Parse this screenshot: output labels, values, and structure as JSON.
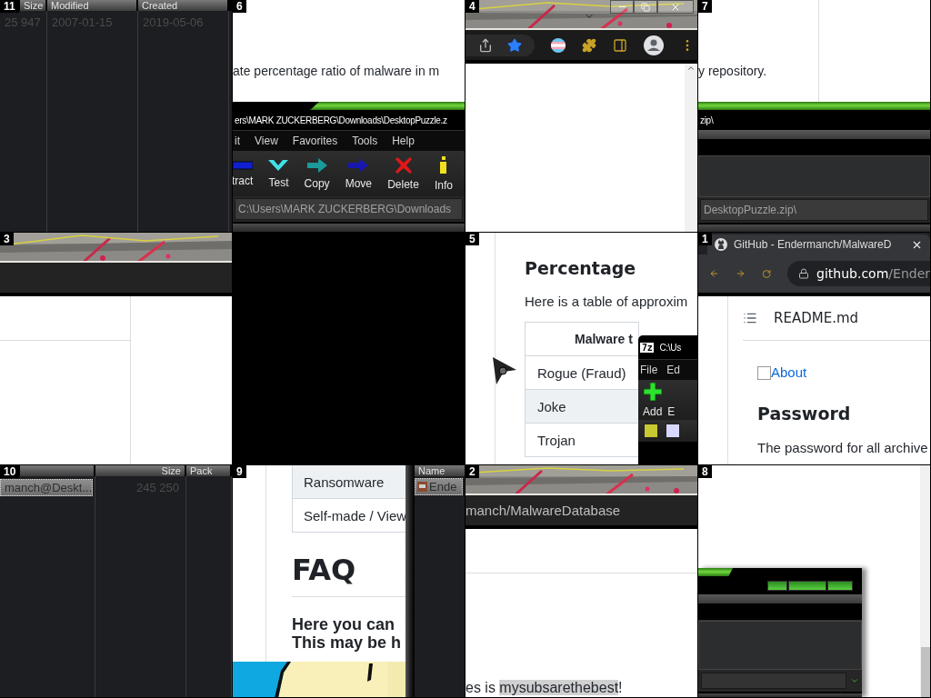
{
  "puzzle": {
    "tiles": [
      {
        "number": "11",
        "kind": "list_dates",
        "headers": [
          "Size",
          "Modified",
          "Created"
        ],
        "rows": [
          {
            "cells": [
              "25 947",
              "2007-01-15",
              "2019-05-06"
            ],
            "selected": false
          }
        ]
      },
      {
        "number": "6",
        "kind": "archive_toolbar",
        "text": "ate percentage ratio of malware in m",
        "title": "ers\\MARK ZUCKERBERG\\Downloads\\DesktopPuzzle.z",
        "menu": [
          "it",
          "View",
          "Favorites",
          "Tools",
          "Help"
        ],
        "tools": [
          {
            "label": "tract",
            "kind": "extract"
          },
          {
            "label": "Test",
            "kind": "test"
          },
          {
            "label": "Copy",
            "kind": "copy"
          },
          {
            "label": "Move",
            "kind": "move"
          },
          {
            "label": "Delete",
            "kind": "delete"
          },
          {
            "label": "Info",
            "kind": "info"
          }
        ],
        "path": "C:\\Users\\MARK ZUCKERBERG\\Downloads"
      },
      {
        "number": "4",
        "kind": "browser_toolbar"
      },
      {
        "number": "7",
        "kind": "archive_path",
        "text": "y repository.",
        "title": "zip\\",
        "path": "DesktopPuzzle.zip\\"
      },
      {
        "number": "3",
        "kind": "picture_bar"
      },
      {
        "kind": "empty"
      },
      {
        "number": "5",
        "kind": "percentage",
        "heading": "Percentage",
        "text": "Here is a table of approxim",
        "column": "Malware t",
        "rows": [
          {
            "label": "Rogue (Fraud)",
            "shaded": false
          },
          {
            "label": "Joke",
            "shaded": true
          },
          {
            "label": "Trojan",
            "shaded": false
          }
        ],
        "window": {
          "logo": "7z",
          "title": "C:\\Us",
          "menu": [
            "File",
            "Ed"
          ],
          "tools": [
            {
              "label": "Add",
              "kind": "add"
            },
            {
              "label": "E",
              "kind": "plain"
            }
          ]
        }
      },
      {
        "number": "1",
        "kind": "github",
        "tab": "GitHub - Endermanch/MalwareD",
        "host": "github.com",
        "path": "/Ender",
        "file": "README.md",
        "link": "About",
        "heading": "Password",
        "text": "The password for all archive"
      },
      {
        "number": "10",
        "kind": "list_names",
        "headers": [
          "Size",
          "Pack"
        ],
        "rows": [
          {
            "cells": [
              "manch@Deskt...",
              "245 250"
            ],
            "selected": true
          }
        ]
      },
      {
        "number": "9",
        "kind": "faq",
        "rows": [
          {
            "label": "Ransomware",
            "shaded": true
          },
          {
            "label": "Self-made / View",
            "shaded": false
          }
        ],
        "heading": "FAQ",
        "lines": [
          "Here you can",
          "This may be h"
        ],
        "list_header": "Name",
        "list_cell": "Ende"
      },
      {
        "number": "2",
        "kind": "address",
        "address": "manch/MalwareDatabase",
        "sentence": {
          "before": "es is ",
          "highlight": "mysubsarethebest",
          "after": "!"
        }
      },
      {
        "number": "8",
        "kind": "window_corner"
      }
    ]
  }
}
